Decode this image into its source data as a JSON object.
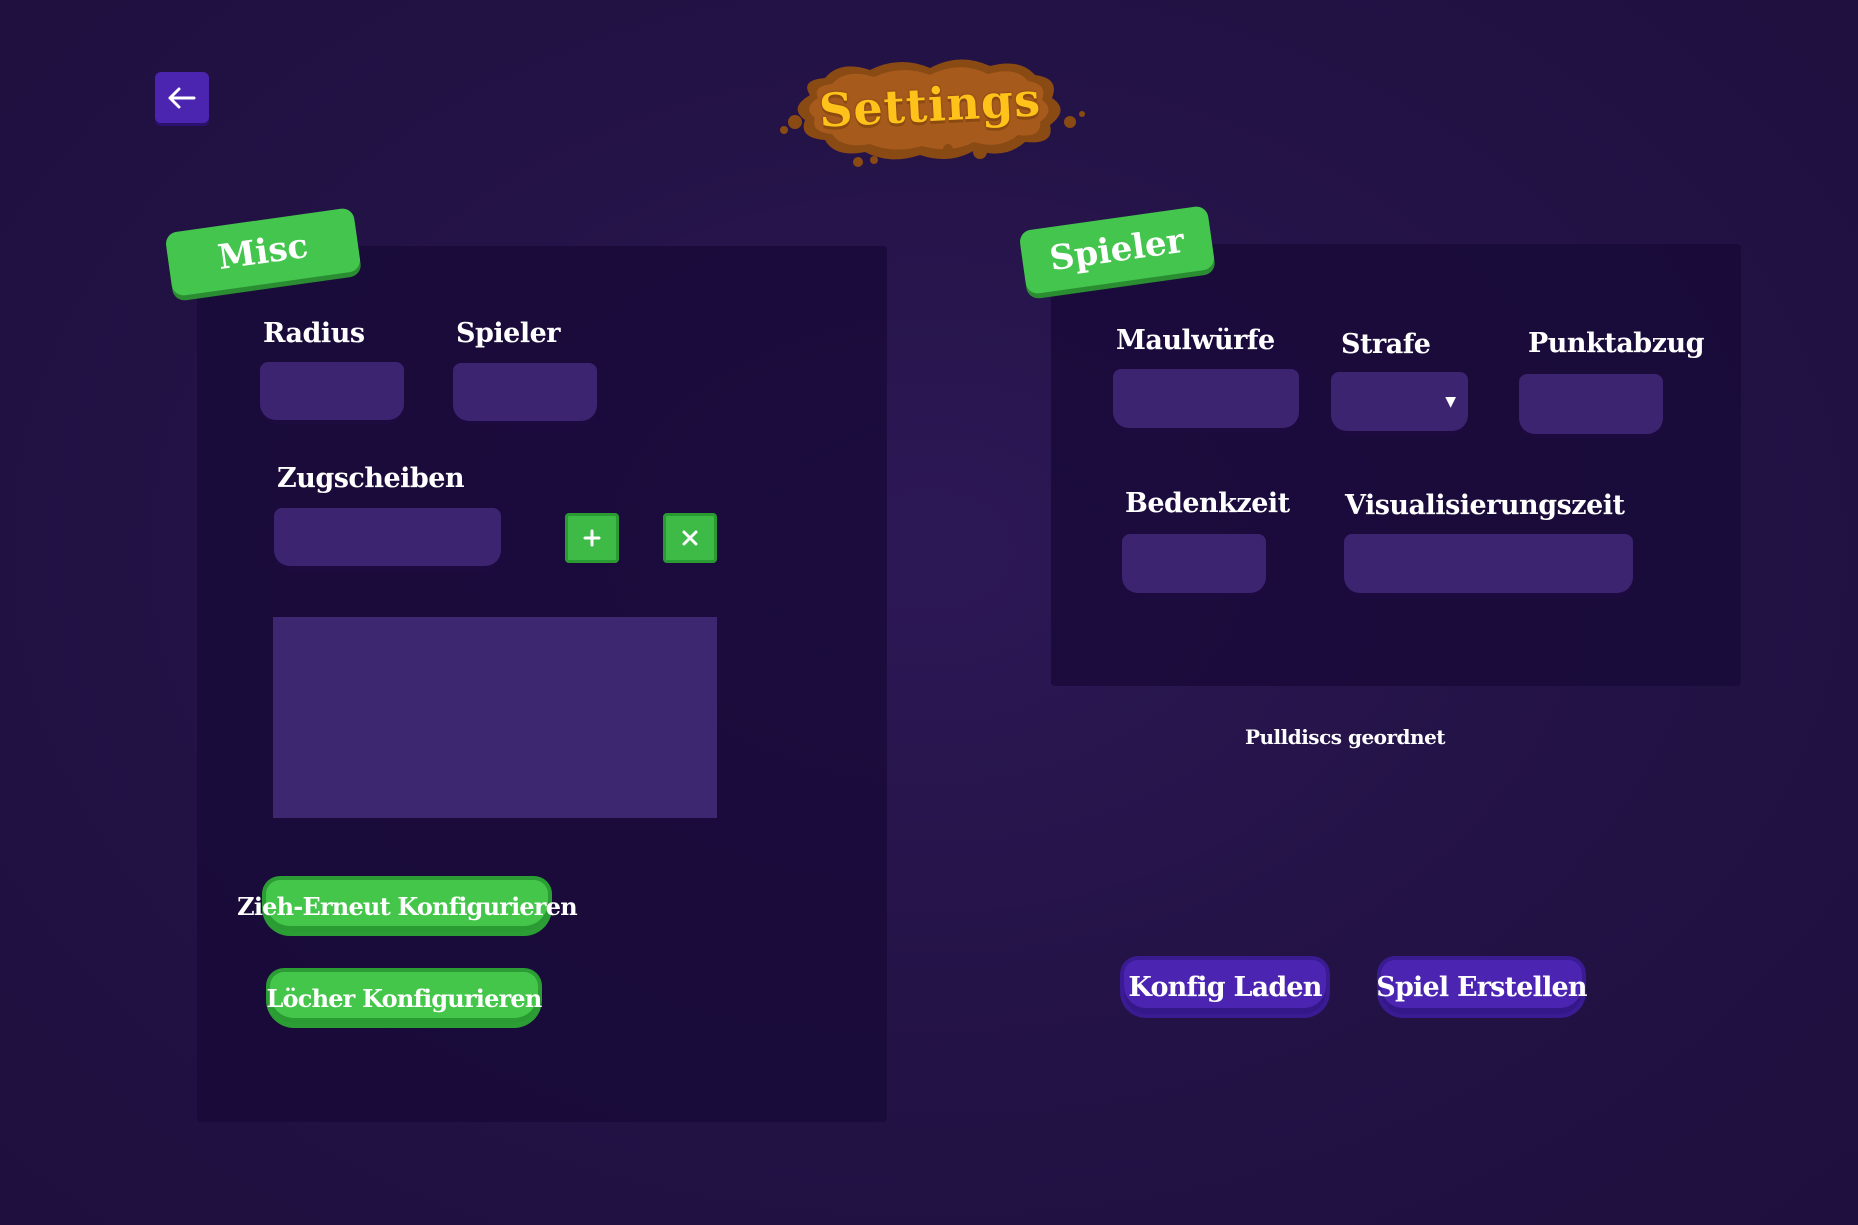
{
  "header": {
    "title": "Settings",
    "back_icon": "arrow-left-icon"
  },
  "misc": {
    "tag": "Misc",
    "radius_label": "Radius",
    "spieler_label": "Spieler",
    "zugscheiben_label": "Zugscheiben",
    "add_icon": "plus-icon",
    "remove_icon": "close-icon",
    "redraw_button": "Zieh-Erneut Konfigurieren",
    "holes_button": "Löcher Konfigurieren"
  },
  "spieler": {
    "tag": "Spieler",
    "maulwuerfe_label": "Maulwürfe",
    "strafe_label": "Strafe",
    "punktabzug_label": "Punktabzug",
    "bedenkzeit_label": "Bedenkzeit",
    "visualisierungszeit_label": "Visualisierungszeit",
    "strafe_arrow_icon": "caret-down-icon"
  },
  "status": {
    "pulldiscs": "Pulldiscs geordnet"
  },
  "actions": {
    "load_label": "Konfig Laden",
    "create_label": "Spiel  Erstellen"
  },
  "colors": {
    "background": "#241347",
    "panel": "#1c0b40",
    "field": "#3d2470",
    "accent_green": "#44c54d",
    "accent_purple": "#4b25b1",
    "title_gold": "#ffc21a"
  }
}
